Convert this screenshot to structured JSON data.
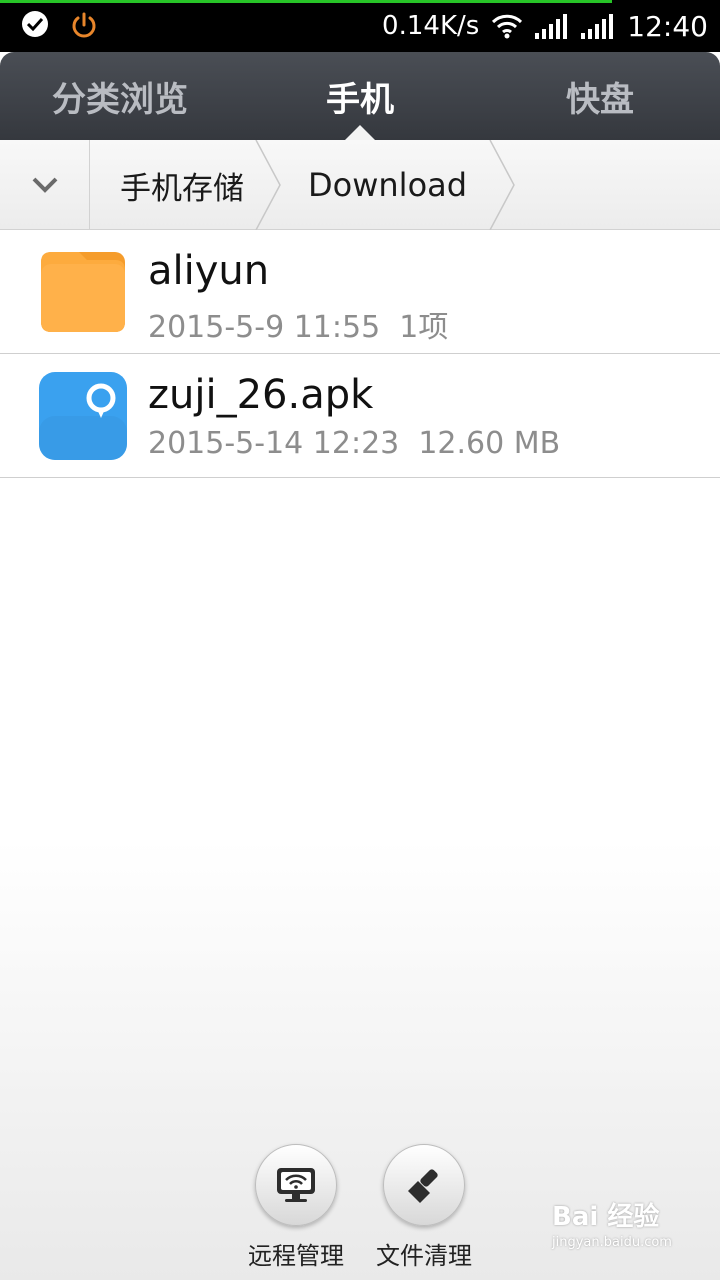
{
  "status_bar": {
    "net_speed": "0.14K/s",
    "time": "12:40",
    "icons": [
      "check-circle-icon",
      "power-icon",
      "wifi-icon",
      "signal-icon",
      "signal-icon"
    ]
  },
  "tabs": [
    {
      "label": "分类浏览",
      "active": false
    },
    {
      "label": "手机",
      "active": true
    },
    {
      "label": "快盘",
      "active": false
    }
  ],
  "breadcrumb": {
    "items": [
      "手机存储",
      "Download"
    ]
  },
  "files": [
    {
      "name": "aliyun",
      "meta": "2015-5-9 11:55  1项",
      "icon": "folder-icon"
    },
    {
      "name": "zuji_26.apk",
      "meta": "2015-5-14 12:23  12.60 MB",
      "icon": "apk-app-icon"
    }
  ],
  "actions": {
    "remote_label": "远程管理",
    "clean_label": "文件清理"
  },
  "watermark": {
    "logo": "Bai 经验",
    "url": "jingyan.baidu.com"
  },
  "colors": {
    "folder": "#fdab3e",
    "apk": "#3aa1ef",
    "tab_active": "#ffffff",
    "tab_inactive": "#b9bcc2"
  }
}
